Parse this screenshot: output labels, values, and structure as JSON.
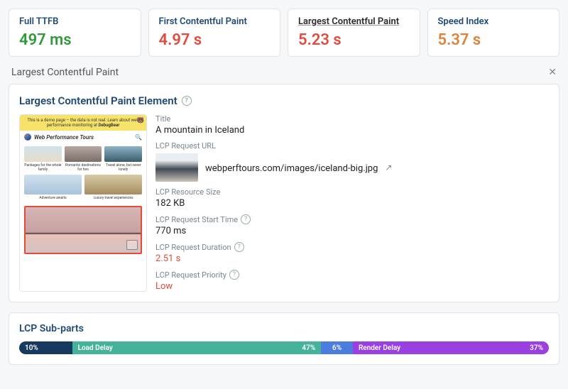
{
  "metrics": [
    {
      "label": "Full TTFB",
      "value": "497 ms",
      "color": "val-green",
      "underlined": false
    },
    {
      "label": "First Contentful Paint",
      "value": "4.97 s",
      "color": "val-red",
      "underlined": false
    },
    {
      "label": "Largest Contentful Paint",
      "value": "5.23 s",
      "color": "val-red",
      "underlined": true
    },
    {
      "label": "Speed Index",
      "value": "5.37 s",
      "color": "val-orange",
      "underlined": false
    }
  ],
  "section_heading": "Largest Contentful Paint",
  "lcp_element": {
    "panel_title": "Largest Contentful Paint Element",
    "title_label": "Title",
    "title_value": "A mountain in Iceland",
    "url_label": "LCP Request URL",
    "url_value": "webperftours.com/images/iceland-big.jpg",
    "size_label": "LCP Resource Size",
    "size_value": "182 KB",
    "start_label": "LCP Request Start Time",
    "start_value": "770 ms",
    "duration_label": "LCP Request Duration",
    "duration_value": "2.51 s",
    "priority_label": "LCP Request Priority",
    "priority_value": "Low"
  },
  "preview": {
    "banner_text": "This is a demo page – the data is not real. Learn about web performance monitoring at",
    "banner_brand": "DebugBear",
    "site_name": "Web Performance Tours",
    "cards": [
      "Packages for the whole family",
      "Romantic destinations for two",
      "Travel alone, but never lonely",
      "Adventure awaits",
      "Luxury travel experiences"
    ]
  },
  "subparts": {
    "title": "LCP Sub-parts",
    "segments": [
      {
        "label": "",
        "pct": "10%",
        "width": 10
      },
      {
        "label": "Load Delay",
        "pct": "47%",
        "width": 47
      },
      {
        "label": "",
        "pct": "6%",
        "width": 6
      },
      {
        "label": "Render Delay",
        "pct": "37%",
        "width": 37
      }
    ]
  }
}
